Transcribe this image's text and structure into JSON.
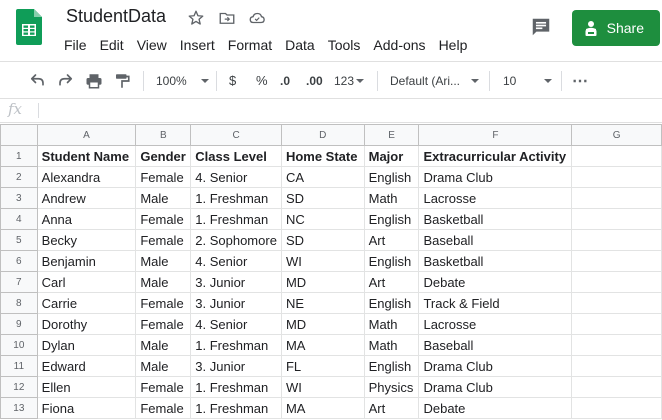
{
  "doc_title": "StudentData",
  "menu": [
    "File",
    "Edit",
    "View",
    "Insert",
    "Format",
    "Data",
    "Tools",
    "Add-ons",
    "Help"
  ],
  "share_label": "Share",
  "toolbar": {
    "zoom": "100%",
    "currency": "$",
    "percent": "%",
    "decrease_decimal": ".0",
    "increase_decimal": ".00",
    "more_formats": "123",
    "font": "Default (Ari...",
    "font_size": "10",
    "more": "⋯"
  },
  "formula_bar": {
    "fx": "fx",
    "value": ""
  },
  "colors": {
    "brand_green": "#1e8e3e",
    "sheets_icon_green": "#0f9d58"
  },
  "columns": [
    "A",
    "B",
    "C",
    "D",
    "E",
    "F",
    "G"
  ],
  "headers": [
    "Student Name",
    "Gender",
    "Class Level",
    "Home State",
    "Major",
    "Extracurricular Activity",
    ""
  ],
  "rows": [
    [
      "Alexandra",
      "Female",
      "4. Senior",
      "CA",
      "English",
      "Drama Club",
      ""
    ],
    [
      "Andrew",
      "Male",
      "1. Freshman",
      "SD",
      "Math",
      "Lacrosse",
      ""
    ],
    [
      "Anna",
      "Female",
      "1. Freshman",
      "NC",
      "English",
      "Basketball",
      ""
    ],
    [
      "Becky",
      "Female",
      "2. Sophomore",
      "SD",
      "Art",
      "Baseball",
      ""
    ],
    [
      "Benjamin",
      "Male",
      "4. Senior",
      "WI",
      "English",
      "Basketball",
      ""
    ],
    [
      "Carl",
      "Male",
      "3. Junior",
      "MD",
      "Art",
      "Debate",
      ""
    ],
    [
      "Carrie",
      "Female",
      "3. Junior",
      "NE",
      "English",
      "Track & Field",
      ""
    ],
    [
      "Dorothy",
      "Female",
      "4. Senior",
      "MD",
      "Math",
      "Lacrosse",
      ""
    ],
    [
      "Dylan",
      "Male",
      "1. Freshman",
      "MA",
      "Math",
      "Baseball",
      ""
    ],
    [
      "Edward",
      "Male",
      "3. Junior",
      "FL",
      "English",
      "Drama Club",
      ""
    ],
    [
      "Ellen",
      "Female",
      "1. Freshman",
      "WI",
      "Physics",
      "Drama Club",
      ""
    ],
    [
      "Fiona",
      "Female",
      "1. Freshman",
      "MA",
      "Art",
      "Debate",
      ""
    ]
  ]
}
